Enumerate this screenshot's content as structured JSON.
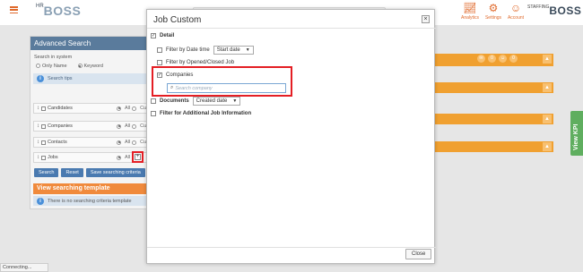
{
  "header": {
    "logo_left_small": "HR",
    "logo_left_big": "BOSS",
    "logo_right_small": "STAFFING",
    "logo_right_big": "BOSS",
    "nav": {
      "analytics": "Analytics",
      "settings": "Settings",
      "account": "Account"
    },
    "icons": {
      "menu": "hamburger-menu-icon",
      "analytics": "chart-icon",
      "settings": "gear-icon",
      "account": "person-icon"
    },
    "accent_color": "#e06a2c"
  },
  "advanced_search": {
    "title": "Advanced Search",
    "search_in_label": "Search in system",
    "radio_only_name": "Only Name",
    "radio_keyword": "Keyword",
    "tips": "Search tips",
    "categories": [
      {
        "name": "Candidates",
        "all": "All",
        "cut": "Cu"
      },
      {
        "name": "Companies",
        "all": "All",
        "cut": "Cu"
      },
      {
        "name": "Contacts",
        "all": "All",
        "cut": "Cu"
      },
      {
        "name": "Jobs",
        "all": "All",
        "cut": "C"
      }
    ],
    "buttons": {
      "search": "Search",
      "reset": "Reset",
      "save": "Save searching criteria"
    },
    "view_template_title": "View searching template",
    "no_template": "There is no searching criteria template"
  },
  "right_side": {
    "kpi_tab": "View KPI",
    "badge_count": "0"
  },
  "modal": {
    "title": "Job Custom",
    "close_x": "×",
    "detail_label": "Detail",
    "filter_date_label": "Filter by Date time",
    "filter_date_value": "Start date",
    "filter_opened_label": "Filter by Opened/Closed Job",
    "companies_label": "Companies",
    "search_company_placeholder": "Search company",
    "documents_label": "Documents",
    "documents_value": "Created date",
    "additional_label": "Filter for Additional Job Information",
    "close_button": "Close",
    "checked_mark": "✓"
  },
  "status_bar": "Connecting..."
}
